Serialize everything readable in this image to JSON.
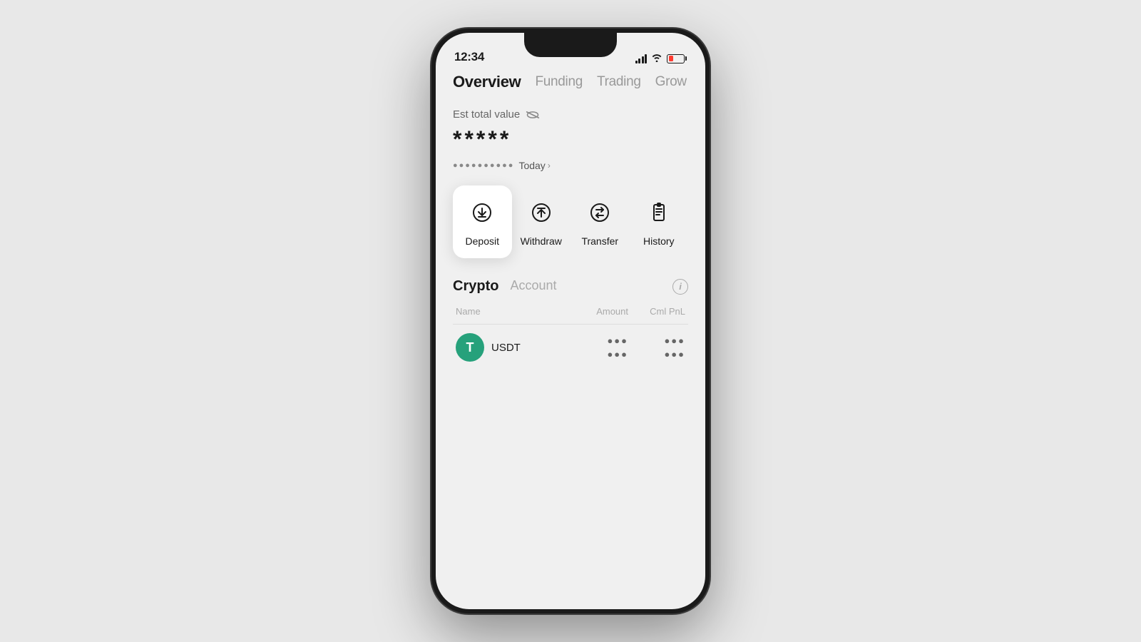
{
  "statusBar": {
    "time": "12:34",
    "battery_level": "14"
  },
  "navTabs": [
    {
      "id": "overview",
      "label": "Overview",
      "active": true
    },
    {
      "id": "funding",
      "label": "Funding",
      "active": false
    },
    {
      "id": "trading",
      "label": "Trading",
      "active": false
    },
    {
      "id": "grow",
      "label": "Grow",
      "active": false
    }
  ],
  "balance": {
    "label": "Est total value",
    "hidden_value": "*****",
    "hidden_change": "●●●●●●●●●●",
    "today_label": "Today"
  },
  "actions": [
    {
      "id": "deposit",
      "label": "Deposit",
      "icon": "download-icon",
      "active": true
    },
    {
      "id": "withdraw",
      "label": "Withdraw",
      "icon": "upload-icon",
      "active": false
    },
    {
      "id": "transfer",
      "label": "Transfer",
      "icon": "transfer-icon",
      "active": false
    },
    {
      "id": "history",
      "label": "History",
      "icon": "history-icon",
      "active": false
    }
  ],
  "cryptoSection": {
    "tabs": [
      {
        "id": "crypto",
        "label": "Crypto",
        "active": true
      },
      {
        "id": "account",
        "label": "Account",
        "active": false
      }
    ],
    "table": {
      "headers": {
        "name": "Name",
        "amount": "Amount",
        "pnl": "Cml PnL"
      },
      "rows": [
        {
          "id": "usdt",
          "icon_letter": "T",
          "icon_color": "#26a17b",
          "name": "USDT",
          "amount_dots": "●●●",
          "amount_dots2": "●●●",
          "pnl_dots": "●●●",
          "pnl_dots2": "●●●"
        }
      ]
    }
  },
  "colors": {
    "background": "#e8e8e8",
    "screen_bg": "#f0f0f0",
    "active_tab": "#1a1a1a",
    "inactive_tab": "#999999",
    "deposit_card_bg": "#ffffff",
    "usdt_green": "#26a17b"
  }
}
